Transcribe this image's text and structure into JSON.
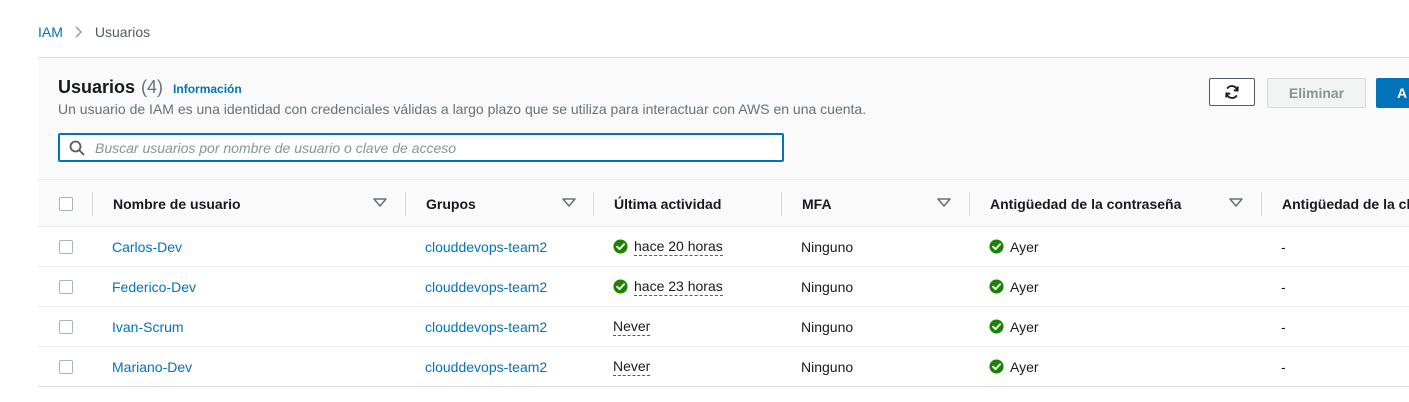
{
  "breadcrumb": {
    "root": "IAM",
    "current": "Usuarios"
  },
  "header": {
    "title": "Usuarios",
    "count": "(4)",
    "info_link": "Información",
    "description": "Un usuario de IAM es una identidad con credenciales válidas a largo plazo que se utiliza para interactuar con AWS en una cuenta."
  },
  "search": {
    "placeholder": "Buscar usuarios por nombre de usuario o clave de acceso",
    "value": ""
  },
  "actions": {
    "refresh_icon": "refresh-icon",
    "delete_label": "Eliminar",
    "add_label": "A"
  },
  "table": {
    "columns": {
      "username": "Nombre de usuario",
      "groups": "Grupos",
      "last_activity": "Última actividad",
      "mfa": "MFA",
      "password_age": "Antigüedad de la contraseña",
      "key_age": "Antigüedad de la cl"
    },
    "rows": [
      {
        "username": "Carlos-Dev",
        "groups": "clouddevops-team2",
        "last_activity": "hace 20 horas",
        "activity_ok": true,
        "mfa": "Ninguno",
        "password_age": "Ayer",
        "key_age": "-"
      },
      {
        "username": "Federico-Dev",
        "groups": "clouddevops-team2",
        "last_activity": "hace 23 horas",
        "activity_ok": true,
        "mfa": "Ninguno",
        "password_age": "Ayer",
        "key_age": "-"
      },
      {
        "username": "Ivan-Scrum",
        "groups": "clouddevops-team2",
        "last_activity": "Never",
        "activity_ok": false,
        "mfa": "Ninguno",
        "password_age": "Ayer",
        "key_age": "-"
      },
      {
        "username": "Mariano-Dev",
        "groups": "clouddevops-team2",
        "last_activity": "Never",
        "activity_ok": false,
        "mfa": "Ninguno",
        "password_age": "Ayer",
        "key_age": "-"
      }
    ]
  },
  "colors": {
    "link": "#0073bb",
    "success": "#1d8102",
    "primary_button": "#0073bb"
  }
}
